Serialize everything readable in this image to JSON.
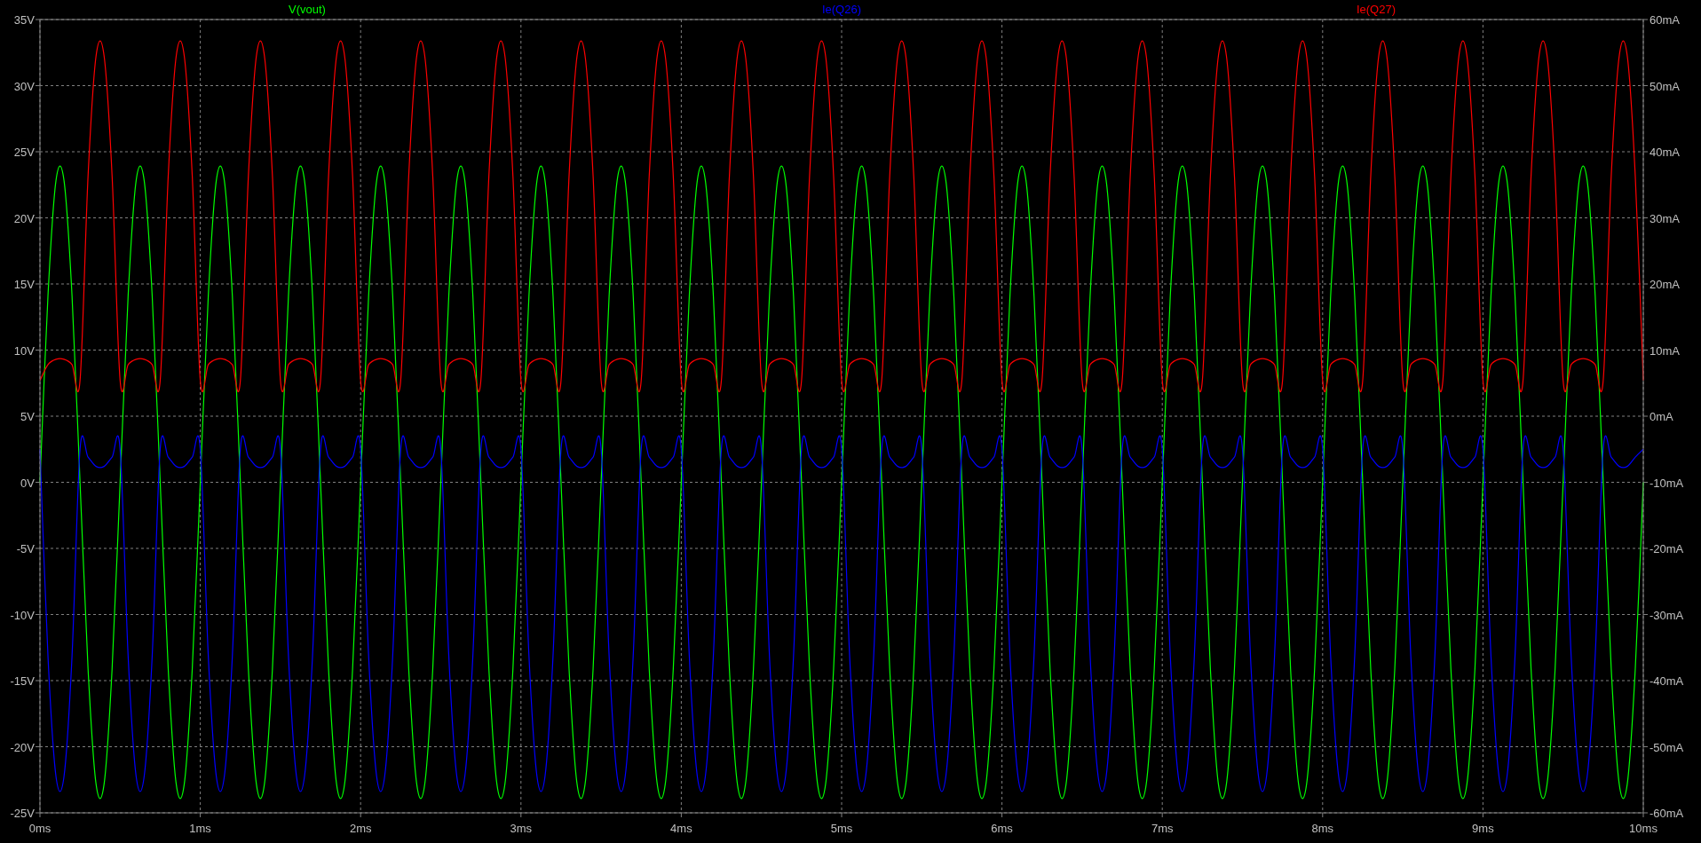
{
  "plot": {
    "chart_data": {
      "type": "line",
      "grid": true,
      "xlim": [
        0,
        10
      ],
      "ylim": [
        -25,
        35
      ],
      "y2lim": [
        -60,
        60
      ],
      "xticks": [
        {
          "value": 0,
          "label": "0ms"
        },
        {
          "value": 1,
          "label": "1ms"
        },
        {
          "value": 2,
          "label": "2ms"
        },
        {
          "value": 3,
          "label": "3ms"
        },
        {
          "value": 4,
          "label": "4ms"
        },
        {
          "value": 5,
          "label": "5ms"
        },
        {
          "value": 6,
          "label": "6ms"
        },
        {
          "value": 7,
          "label": "7ms"
        },
        {
          "value": 8,
          "label": "8ms"
        },
        {
          "value": 9,
          "label": "9ms"
        },
        {
          "value": 10,
          "label": "10ms"
        }
      ],
      "yticks": [
        {
          "value": 35,
          "label": "35V"
        },
        {
          "value": 30,
          "label": "30V"
        },
        {
          "value": 25,
          "label": "25V"
        },
        {
          "value": 20,
          "label": "20V"
        },
        {
          "value": 15,
          "label": "15V"
        },
        {
          "value": 10,
          "label": "10V"
        },
        {
          "value": 5,
          "label": "5V"
        },
        {
          "value": 0,
          "label": "0V"
        },
        {
          "value": -5,
          "label": "-5V"
        },
        {
          "value": -10,
          "label": "-10V"
        },
        {
          "value": -15,
          "label": "-15V"
        },
        {
          "value": -20,
          "label": "-20V"
        },
        {
          "value": -25,
          "label": "-25V"
        }
      ],
      "y2ticks": [
        {
          "value": 60,
          "label": "60mA"
        },
        {
          "value": 50,
          "label": "50mA"
        },
        {
          "value": 40,
          "label": "40mA"
        },
        {
          "value": 30,
          "label": "30mA"
        },
        {
          "value": 20,
          "label": "20mA"
        },
        {
          "value": 10,
          "label": "10mA"
        },
        {
          "value": 0,
          "label": "0mA"
        },
        {
          "value": -10,
          "label": "-10mA"
        },
        {
          "value": -20,
          "label": "-20mA"
        },
        {
          "value": -30,
          "label": "-30mA"
        },
        {
          "value": -40,
          "label": "-40mA"
        },
        {
          "value": -50,
          "label": "-50mA"
        },
        {
          "value": -60,
          "label": "-60mA"
        }
      ],
      "x": [
        0,
        0.05,
        0.1,
        0.15,
        0.2,
        0.25,
        0.3,
        0.35,
        0.4,
        0.45,
        0.5,
        0.55,
        0.6,
        0.65,
        0.7,
        0.75,
        0.8,
        0.85,
        0.9,
        0.95,
        1,
        1.05,
        1.1,
        1.15,
        1.2,
        1.25,
        1.3,
        1.35,
        1.4,
        1.45,
        1.5,
        1.55,
        1.6,
        1.65,
        1.7,
        1.75,
        1.8,
        1.85,
        1.9,
        1.95,
        2,
        2.05,
        2.1,
        2.15,
        2.2,
        2.25,
        2.3,
        2.35,
        2.4,
        2.45,
        2.5,
        2.55,
        2.6,
        2.65,
        2.7,
        2.75,
        2.8,
        2.85,
        2.9,
        2.95,
        3,
        3.05,
        3.1,
        3.15,
        3.2,
        3.25,
        3.3,
        3.35,
        3.4,
        3.45,
        3.5,
        3.55,
        3.6,
        3.65,
        3.7,
        3.75,
        3.8,
        3.85,
        3.9,
        3.95,
        4,
        4.05,
        4.1,
        4.15,
        4.2,
        4.25,
        4.3,
        4.35,
        4.4,
        4.45,
        4.5,
        4.55,
        4.6,
        4.65,
        4.7,
        4.75,
        4.8,
        4.85,
        4.9,
        4.95,
        5,
        5.05,
        5.1,
        5.15,
        5.2,
        5.25,
        5.3,
        5.35,
        5.4,
        5.45,
        5.5,
        5.55,
        5.6,
        5.65,
        5.7,
        5.75,
        5.8,
        5.85,
        5.9,
        5.95,
        6,
        6.05,
        6.1,
        6.15,
        6.2,
        6.25,
        6.3,
        6.35,
        6.4,
        6.45,
        6.5,
        6.55,
        6.6,
        6.65,
        6.7,
        6.75,
        6.8,
        6.85,
        6.9,
        6.95,
        7,
        7.05,
        7.1,
        7.15,
        7.2,
        7.25,
        7.3,
        7.35,
        7.4,
        7.45,
        7.5,
        7.55,
        7.6,
        7.65,
        7.7,
        7.75,
        7.8,
        7.85,
        7.9,
        7.95,
        8,
        8.05,
        8.1,
        8.15,
        8.2,
        8.25,
        8.3,
        8.35,
        8.4,
        8.45,
        8.5,
        8.55,
        8.6,
        8.65,
        8.7,
        8.75,
        8.8,
        8.85,
        8.9,
        8.95,
        9,
        9.05,
        9.1,
        9.15,
        9.2,
        9.25,
        9.3,
        9.35,
        9.4,
        9.45,
        9.5,
        9.55,
        9.6,
        9.65,
        9.7,
        9.75,
        9.8,
        9.85,
        9.9,
        9.95,
        10
      ],
      "series": [
        {
          "name": "V(vout)",
          "color": "#00ff00",
          "values": [
            0,
            14.11,
            22.83,
            22.83,
            14.11,
            0,
            -14.11,
            -22.83,
            -22.83,
            -14.11,
            0,
            14.11,
            22.83,
            22.83,
            14.11,
            0,
            -14.11,
            -22.83,
            -22.83,
            -14.11,
            0,
            14.11,
            22.83,
            22.83,
            14.11,
            0,
            -14.11,
            -22.83,
            -22.83,
            -14.11,
            0,
            14.11,
            22.83,
            22.83,
            14.11,
            0,
            -14.11,
            -22.83,
            -22.83,
            -14.11,
            0,
            14.11,
            22.83,
            22.83,
            14.11,
            0,
            -14.11,
            -22.83,
            -22.83,
            -14.11,
            0,
            14.11,
            22.83,
            22.83,
            14.11,
            0,
            -14.11,
            -22.83,
            -22.83,
            -14.11,
            0,
            14.11,
            22.83,
            22.83,
            14.11,
            0,
            -14.11,
            -22.83,
            -22.83,
            -14.11,
            0,
            14.11,
            22.83,
            22.83,
            14.11,
            0,
            -14.11,
            -22.83,
            -22.83,
            -14.11,
            0,
            14.11,
            22.83,
            22.83,
            14.11,
            0,
            -14.11,
            -22.83,
            -22.83,
            -14.11,
            0,
            14.11,
            22.83,
            22.83,
            14.11,
            0,
            -14.11,
            -22.83,
            -22.83,
            -14.11,
            0,
            14.11,
            22.83,
            22.83,
            14.11,
            0,
            -14.11,
            -22.83,
            -22.83,
            -14.11,
            0,
            14.11,
            22.83,
            22.83,
            14.11,
            0,
            -14.11,
            -22.83,
            -22.83,
            -14.11,
            0,
            14.11,
            22.83,
            22.83,
            14.11,
            0,
            -14.11,
            -22.83,
            -22.83,
            -14.11,
            0,
            14.11,
            22.83,
            22.83,
            14.11,
            0,
            -14.11,
            -22.83,
            -22.83,
            -14.11,
            0,
            14.11,
            22.83,
            22.83,
            14.11,
            0,
            -14.11,
            -22.83,
            -22.83,
            -14.11,
            0,
            14.11,
            22.83,
            22.83,
            14.11,
            0,
            -14.11,
            -22.83,
            -22.83,
            -14.11,
            0,
            14.11,
            22.83,
            22.83,
            14.11,
            0,
            -14.11,
            -22.83,
            -22.83,
            -14.11,
            0,
            14.11,
            22.83,
            22.83,
            14.11,
            0,
            -14.11,
            -22.83,
            -22.83,
            -14.11,
            0,
            14.11,
            22.83,
            22.83,
            14.11,
            0,
            -14.11,
            -22.83,
            -22.83,
            -14.11,
            0,
            14.11,
            22.83,
            22.83,
            14.11,
            0,
            -14.11,
            -22.83,
            -22.83,
            -14.11,
            0
          ]
        },
        {
          "name": "Ie(Q26)",
          "color": "#0000ff",
          "axis": "y2",
          "values": [
            -5,
            -36.3,
            -54.5,
            -54.5,
            -36.3,
            -5,
            -6.2,
            -7.6,
            -7.6,
            -6.2,
            -5,
            -36.3,
            -54.5,
            -54.5,
            -36.3,
            -5,
            -6.2,
            -7.6,
            -7.6,
            -6.2,
            -5,
            -36.3,
            -54.5,
            -54.5,
            -36.3,
            -5,
            -6.2,
            -7.6,
            -7.6,
            -6.2,
            -5,
            -36.3,
            -54.5,
            -54.5,
            -36.3,
            -5,
            -6.2,
            -7.6,
            -7.6,
            -6.2,
            -5,
            -36.3,
            -54.5,
            -54.5,
            -36.3,
            -5,
            -6.2,
            -7.6,
            -7.6,
            -6.2,
            -5,
            -36.3,
            -54.5,
            -54.5,
            -36.3,
            -5,
            -6.2,
            -7.6,
            -7.6,
            -6.2,
            -5,
            -36.3,
            -54.5,
            -54.5,
            -36.3,
            -5,
            -6.2,
            -7.6,
            -7.6,
            -6.2,
            -5,
            -36.3,
            -54.5,
            -54.5,
            -36.3,
            -5,
            -6.2,
            -7.6,
            -7.6,
            -6.2,
            -5,
            -36.3,
            -54.5,
            -54.5,
            -36.3,
            -5,
            -6.2,
            -7.6,
            -7.6,
            -6.2,
            -5,
            -36.3,
            -54.5,
            -54.5,
            -36.3,
            -5,
            -6.2,
            -7.6,
            -7.6,
            -6.2,
            -5,
            -36.3,
            -54.5,
            -54.5,
            -36.3,
            -5,
            -6.2,
            -7.6,
            -7.6,
            -6.2,
            -5,
            -36.3,
            -54.5,
            -54.5,
            -36.3,
            -5,
            -6.2,
            -7.6,
            -7.6,
            -6.2,
            -5,
            -36.3,
            -54.5,
            -54.5,
            -36.3,
            -5,
            -6.2,
            -7.6,
            -7.6,
            -6.2,
            -5,
            -36.3,
            -54.5,
            -54.5,
            -36.3,
            -5,
            -6.2,
            -7.6,
            -7.6,
            -6.2,
            -5,
            -36.3,
            -54.5,
            -54.5,
            -36.3,
            -5,
            -6.2,
            -7.6,
            -7.6,
            -6.2,
            -5,
            -36.3,
            -54.5,
            -54.5,
            -36.3,
            -5,
            -6.2,
            -7.6,
            -7.6,
            -6.2,
            -5,
            -36.3,
            -54.5,
            -54.5,
            -36.3,
            -5,
            -6.2,
            -7.6,
            -7.6,
            -6.2,
            -5,
            -36.3,
            -54.5,
            -54.5,
            -36.3,
            -5,
            -6.2,
            -7.6,
            -7.6,
            -6.2,
            -5,
            -36.3,
            -54.5,
            -54.5,
            -36.3,
            -5,
            -6.2,
            -7.6,
            -7.6,
            -6.2,
            -5,
            -36.3,
            -54.5,
            -54.5,
            -36.3,
            -5,
            -6.2,
            -7.6,
            -7.6,
            -6.2,
            -5
          ]
        },
        {
          "name": "Ie(Q27)",
          "color": "#ff0000",
          "axis": "y2",
          "values": [
            5.4,
            7.8,
            8.6,
            8.6,
            7.8,
            5.4,
            36.3,
            54.5,
            54.5,
            36.3,
            5.4,
            7.8,
            8.6,
            8.6,
            7.8,
            5.4,
            36.3,
            54.5,
            54.5,
            36.3,
            5.4,
            7.8,
            8.6,
            8.6,
            7.8,
            5.4,
            36.3,
            54.5,
            54.5,
            36.3,
            5.4,
            7.8,
            8.6,
            8.6,
            7.8,
            5.4,
            36.3,
            54.5,
            54.5,
            36.3,
            5.4,
            7.8,
            8.6,
            8.6,
            7.8,
            5.4,
            36.3,
            54.5,
            54.5,
            36.3,
            5.4,
            7.8,
            8.6,
            8.6,
            7.8,
            5.4,
            36.3,
            54.5,
            54.5,
            36.3,
            5.4,
            7.8,
            8.6,
            8.6,
            7.8,
            5.4,
            36.3,
            54.5,
            54.5,
            36.3,
            5.4,
            7.8,
            8.6,
            8.6,
            7.8,
            5.4,
            36.3,
            54.5,
            54.5,
            36.3,
            5.4,
            7.8,
            8.6,
            8.6,
            7.8,
            5.4,
            36.3,
            54.5,
            54.5,
            36.3,
            5.4,
            7.8,
            8.6,
            8.6,
            7.8,
            5.4,
            36.3,
            54.5,
            54.5,
            36.3,
            5.4,
            7.8,
            8.6,
            8.6,
            7.8,
            5.4,
            36.3,
            54.5,
            54.5,
            36.3,
            5.4,
            7.8,
            8.6,
            8.6,
            7.8,
            5.4,
            36.3,
            54.5,
            54.5,
            36.3,
            5.4,
            7.8,
            8.6,
            8.6,
            7.8,
            5.4,
            36.3,
            54.5,
            54.5,
            36.3,
            5.4,
            7.8,
            8.6,
            8.6,
            7.8,
            5.4,
            36.3,
            54.5,
            54.5,
            36.3,
            5.4,
            7.8,
            8.6,
            8.6,
            7.8,
            5.4,
            36.3,
            54.5,
            54.5,
            36.3,
            5.4,
            7.8,
            8.6,
            8.6,
            7.8,
            5.4,
            36.3,
            54.5,
            54.5,
            36.3,
            5.4,
            7.8,
            8.6,
            8.6,
            7.8,
            5.4,
            36.3,
            54.5,
            54.5,
            36.3,
            5.4,
            7.8,
            8.6,
            8.6,
            7.8,
            5.4,
            36.3,
            54.5,
            54.5,
            36.3,
            5.4,
            7.8,
            8.6,
            8.6,
            7.8,
            5.4,
            36.3,
            54.5,
            54.5,
            36.3,
            5.4,
            7.8,
            8.6,
            8.6,
            7.8,
            5.4,
            36.3,
            54.5,
            54.5,
            36.3,
            5.4
          ]
        }
      ]
    }
  }
}
